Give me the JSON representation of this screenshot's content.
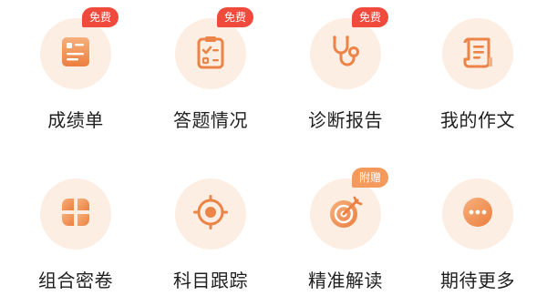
{
  "colors": {
    "icon_bg": "#fdeee3",
    "icon_fg": "#f08c4e",
    "badge_free": "#f04a3c",
    "badge_extra": "#f39a5c",
    "label": "#1f1f1f"
  },
  "tiles": [
    {
      "label": "成绩单",
      "icon": "report-card-icon",
      "badge": "免费"
    },
    {
      "label": "答题情况",
      "icon": "clipboard-checklist-icon",
      "badge": "免费"
    },
    {
      "label": "诊断报告",
      "icon": "stethoscope-icon",
      "badge": "免费"
    },
    {
      "label": "我的作文",
      "icon": "essay-scroll-icon",
      "badge": null
    },
    {
      "label": "组合密卷",
      "icon": "clover-grid-icon",
      "badge": null
    },
    {
      "label": "科目跟踪",
      "icon": "target-crosshair-icon",
      "badge": null
    },
    {
      "label": "精准解读",
      "icon": "dartboard-icon",
      "badge": "附赠"
    },
    {
      "label": "期待更多",
      "icon": "more-dots-icon",
      "badge": null
    }
  ]
}
